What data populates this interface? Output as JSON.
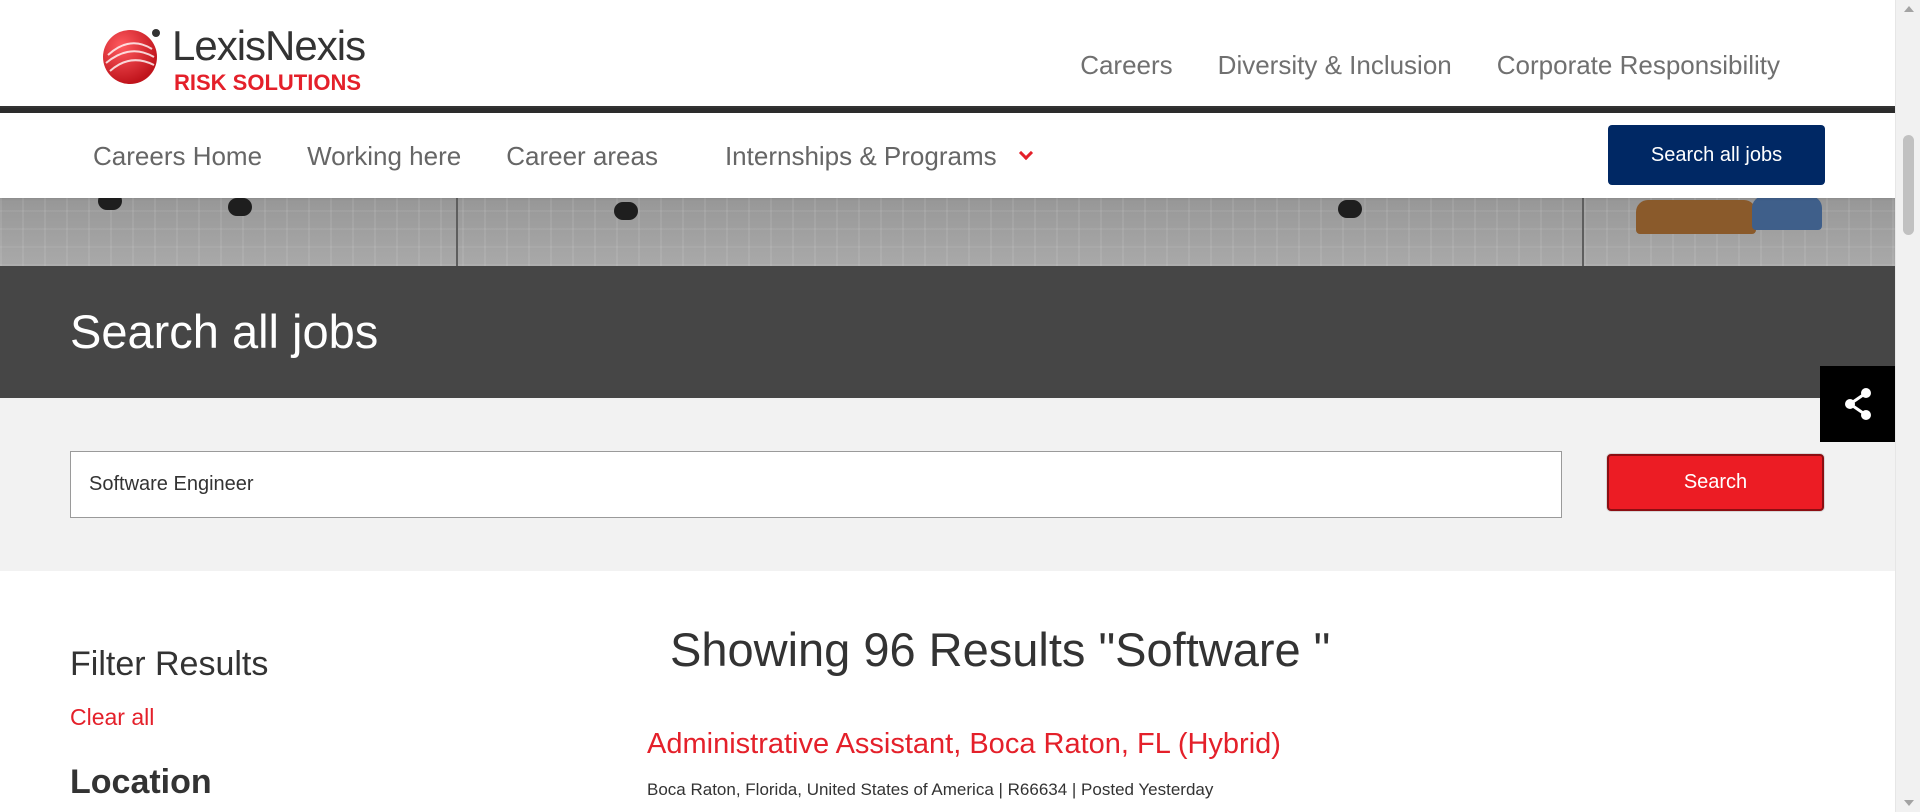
{
  "brand": {
    "name": "LexisNexis",
    "sub": "RISK SOLUTIONS",
    "accent": "#e4202a",
    "navy": "#002864"
  },
  "top_nav": {
    "items": [
      "Careers",
      "Diversity & Inclusion",
      "Corporate Responsibility"
    ]
  },
  "sub_nav": {
    "items": [
      "Careers Home",
      "Working here",
      "Career areas"
    ],
    "dropdown_label": "Internships & Programs",
    "search_all_jobs": "Search all jobs"
  },
  "page": {
    "title": "Search all jobs"
  },
  "search": {
    "value": "Software Engineer",
    "button_label": "Search"
  },
  "filters": {
    "title": "Filter Results",
    "clear_all": "Clear all",
    "location_title": "Location"
  },
  "results": {
    "heading": "Showing 96 Results \"Software \"",
    "first_job": {
      "title": "Administrative Assistant, Boca Raton, FL (Hybrid)",
      "meta": "Boca Raton, Florida, United States of America | R66634 | Posted Yesterday"
    }
  },
  "icons": {
    "share": "share-icon",
    "dropdown": "chevron-down-icon"
  }
}
